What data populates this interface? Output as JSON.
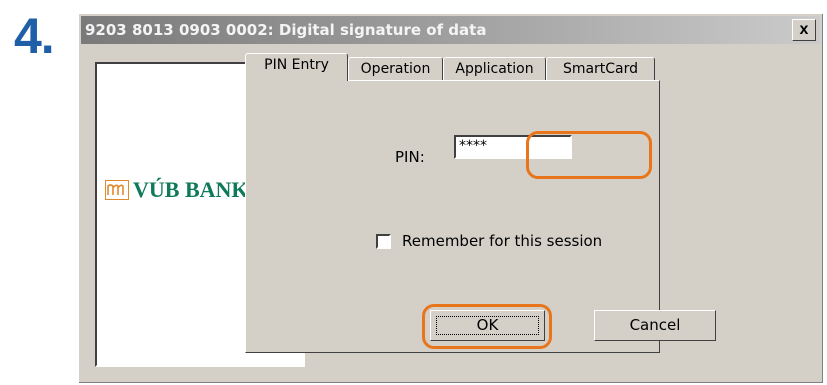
{
  "step": {
    "number": "4."
  },
  "window": {
    "title": "9203 8013 0903 0002: Digital signature of data",
    "close_glyph": "x"
  },
  "logo": {
    "icon": "vub-banka-emblem-icon",
    "text": "VÚB BANKA"
  },
  "tabs": [
    {
      "label": "PIN Entry",
      "active": true
    },
    {
      "label": "Operation",
      "active": false
    },
    {
      "label": "Application",
      "active": false
    },
    {
      "label": "SmartCard",
      "active": false
    }
  ],
  "pin": {
    "label": "PIN:",
    "value": "****"
  },
  "remember": {
    "label": "Remember for this session",
    "checked": false
  },
  "buttons": {
    "ok": "OK",
    "cancel": "Cancel"
  },
  "colors": {
    "highlight": "#e8751a",
    "step_number": "#1f5fa8",
    "bank_green": "#0f7a5a",
    "dialog_face": "#d4d0c8"
  }
}
